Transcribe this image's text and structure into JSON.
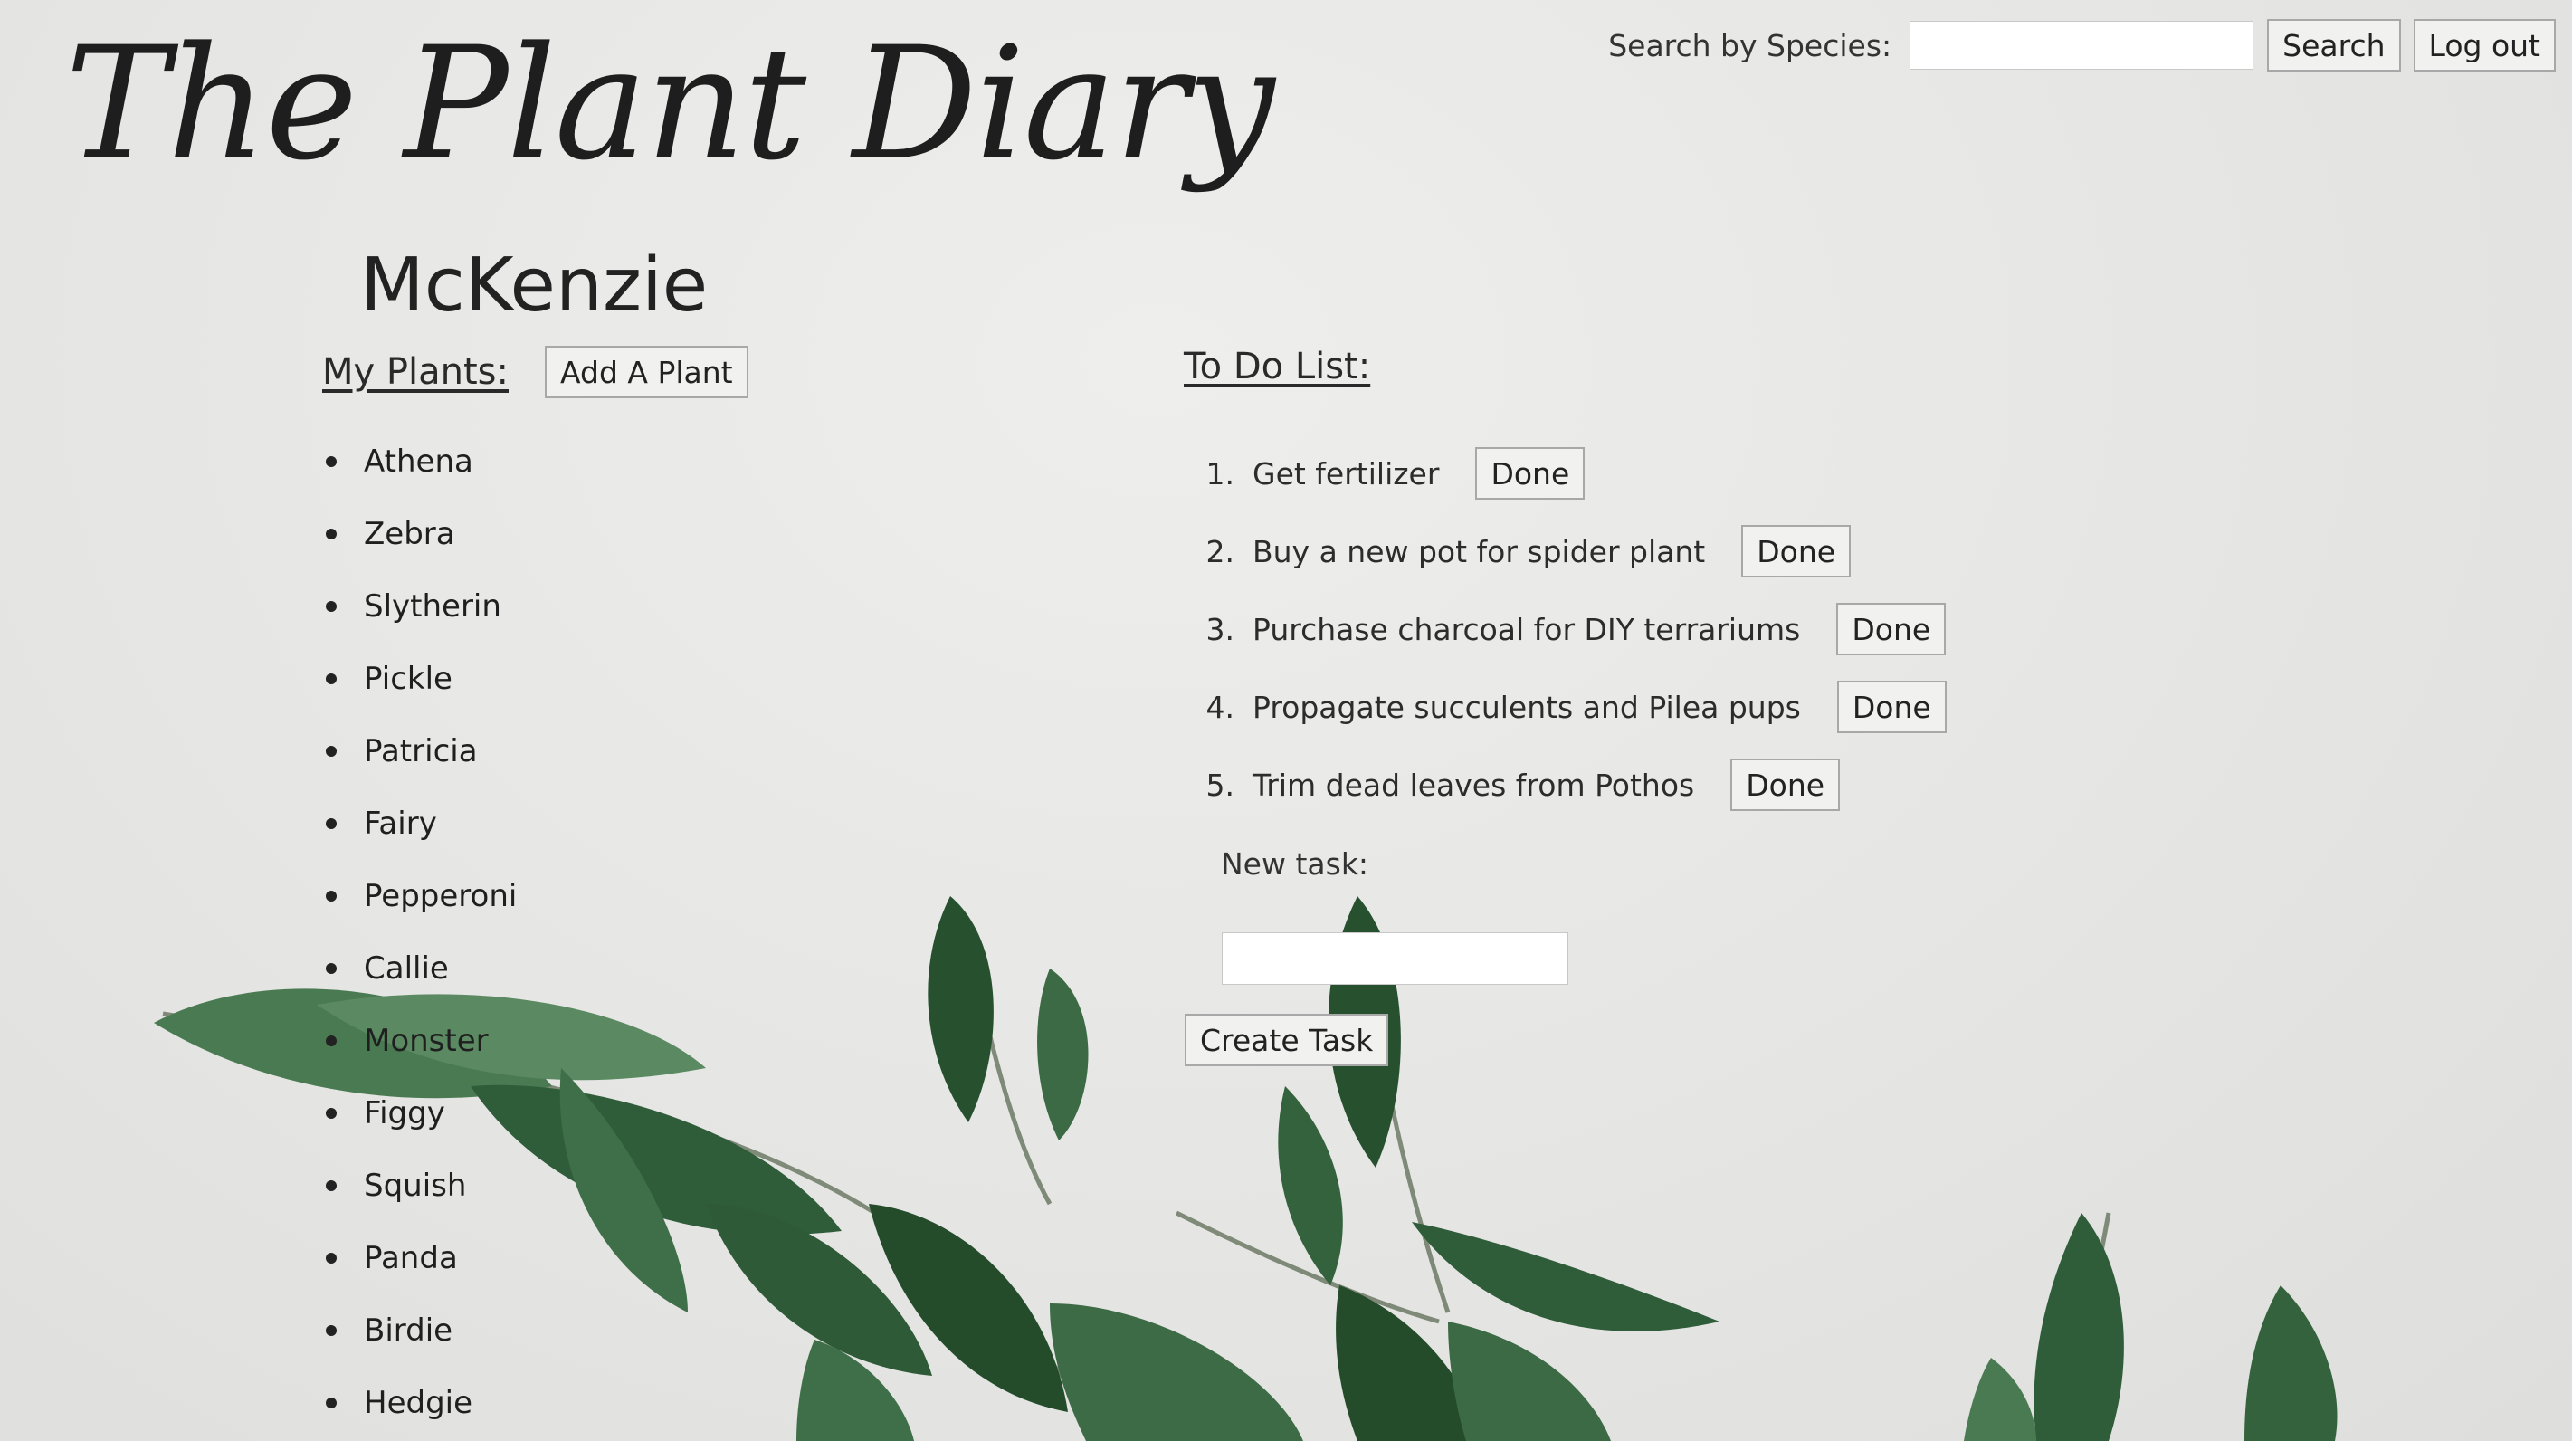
{
  "app": {
    "title": "The Plant Diary"
  },
  "header": {
    "search_label": "Search by Species:",
    "search_value": "",
    "search_button": "Search",
    "logout_button": "Log out"
  },
  "user": {
    "name": "McKenzie"
  },
  "plants": {
    "title": "My Plants:",
    "add_button": "Add A Plant",
    "items": [
      "Athena",
      "Zebra",
      "Slytherin",
      "Pickle",
      "Patricia",
      "Fairy",
      "Pepperoni",
      "Callie",
      "Monster",
      "Figgy",
      "Squish",
      "Panda",
      "Birdie",
      "Hedgie"
    ]
  },
  "todo": {
    "title": "To Do List:",
    "items": [
      {
        "num": "1.",
        "text": "Get fertilizer",
        "button": "Done"
      },
      {
        "num": "2.",
        "text": "Buy a new pot for spider plant",
        "button": "Done"
      },
      {
        "num": "3.",
        "text": "Purchase charcoal for DIY terrariums",
        "button": "Done"
      },
      {
        "num": "4.",
        "text": "Propagate succulents and Pilea pups",
        "button": "Done"
      },
      {
        "num": "5.",
        "text": "Trim dead leaves from Pothos",
        "button": "Done"
      }
    ],
    "new_task_label": "New task:",
    "new_task_value": "",
    "create_button": "Create Task"
  },
  "theme": {
    "background": "#e6e6e4",
    "leaf_dark": "#2f5d3a",
    "leaf_light": "#4f7d57"
  }
}
